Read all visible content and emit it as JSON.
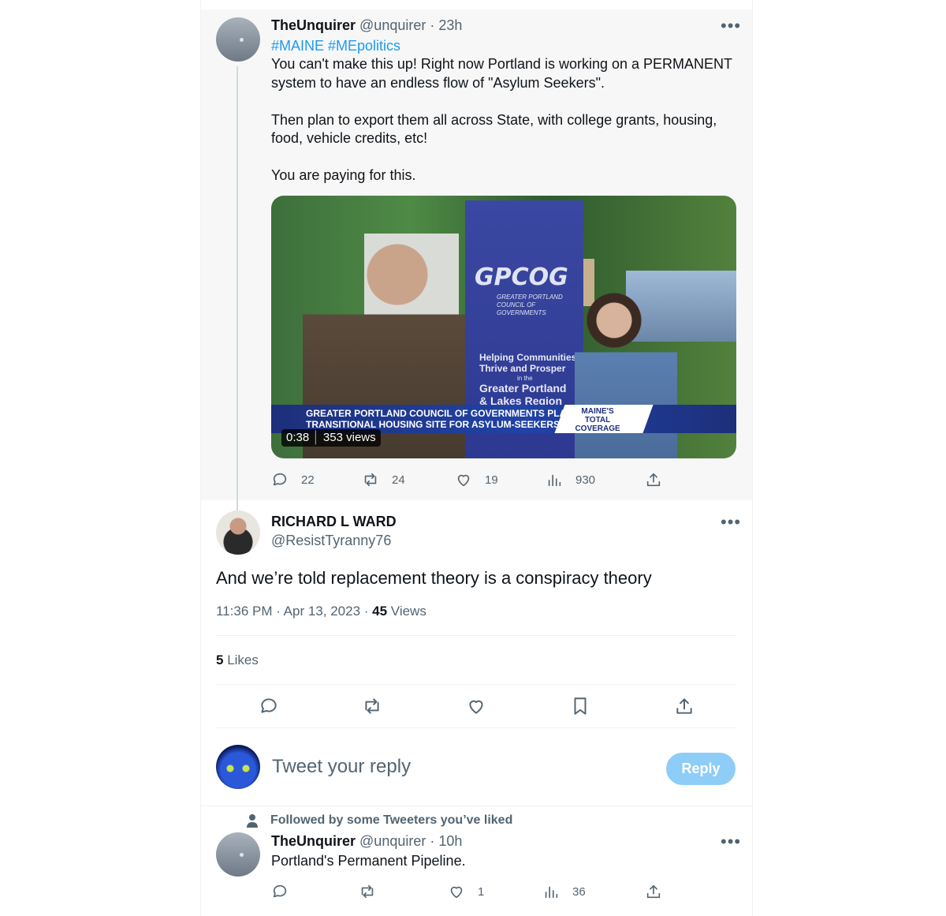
{
  "tweet1": {
    "display_name": "TheUnquirer",
    "handle": "@unquirer",
    "time": "· 23h",
    "hashtags": "#MAINE #MEpolitics",
    "body": "You can't make this up!  Right now Portland is working on a PERMANENT\nsystem to have an endless flow of \"Asylum Seekers\".\n\nThen  plan to export them all across State, with college grants, housing,\nfood, vehicle credits, etc!\n\nYou are paying for this.",
    "video": {
      "logo": "GPCOG",
      "org_small": "GREATER PORTLAND\nCOUNCIL OF GOVERNMENTS",
      "slogan": "Helping Communities Thrive and Prosper",
      "slogan_in": "in the",
      "region": "Greater Portland\n& Lakes Region",
      "headline": "GREATER PORTLAND COUNCIL OF GOVERNMENTS PLANS\nTRANSITIONAL HOUSING SITE FOR ASYLUM-SEEKERS",
      "brand": "MAINE'S\nTOTAL\nCOVERAGE",
      "duration": "0:38",
      "views": "353 views"
    },
    "replies": "22",
    "retweets": "24",
    "likes": "19",
    "views": "930"
  },
  "tweet2": {
    "display_name": "RICHARD L WARD",
    "handle": "@ResistTyranny76",
    "body": "And we’re told replacement theory is a conspiracy theory",
    "timestamp": "11:36 PM · Apr 13, 2023 · ",
    "view_count": "45",
    "views_label": " Views",
    "like_count": "5",
    "likes_label": " Likes"
  },
  "reply_box": {
    "placeholder": "Tweet your reply",
    "button": "Reply"
  },
  "tweet3": {
    "context": "Followed by some Tweeters you’ve liked",
    "display_name": "TheUnquirer",
    "handle": "@unquirer",
    "time": "· 10h",
    "body": "Portland's Permanent Pipeline.",
    "likes": "1",
    "views": "36"
  },
  "colors": {
    "accent": "#1d9bf0",
    "muted": "#536471",
    "reply_button": "#8ecdf8"
  }
}
